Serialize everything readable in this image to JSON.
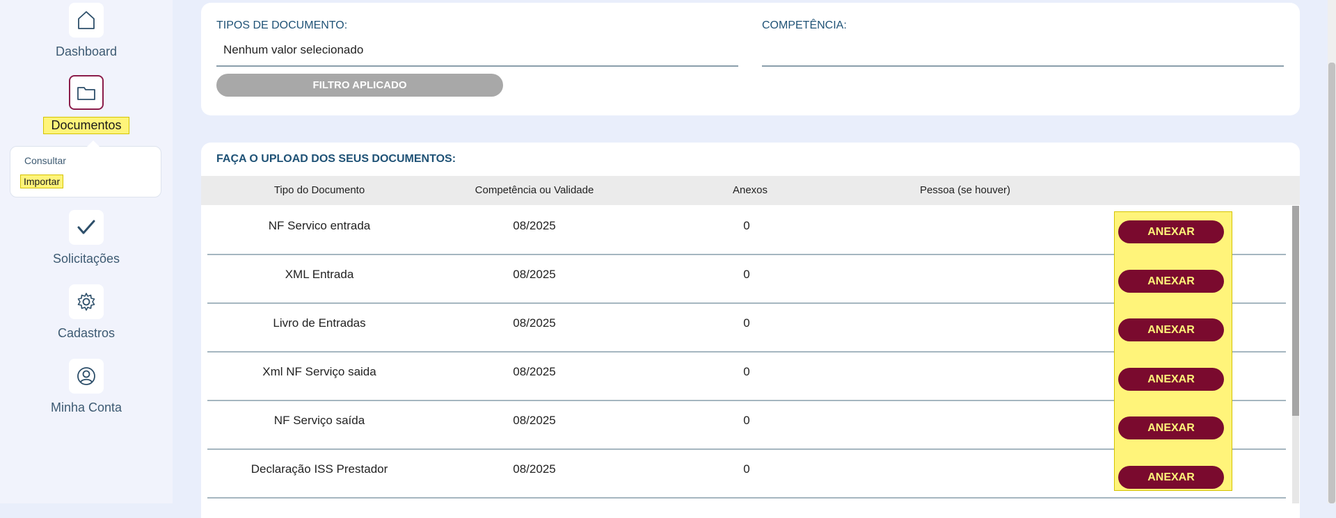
{
  "sidebar": {
    "items": [
      {
        "label": "Dashboard",
        "icon": "home-icon"
      },
      {
        "label": "Documentos",
        "icon": "folder-icon"
      },
      {
        "label": "Solicitações",
        "icon": "check-icon"
      },
      {
        "label": "Cadastros",
        "icon": "gear-icon"
      },
      {
        "label": "Minha Conta",
        "icon": "user-icon"
      }
    ],
    "submenu": {
      "consultar": "Consultar",
      "importar": "Importar"
    }
  },
  "filters": {
    "tipos_label": "TIPOS DE DOCUMENTO:",
    "tipos_value": "Nenhum valor selecionado",
    "competencia_label": "COMPETÊNCIA:",
    "competencia_value": "",
    "button_label": "FILTRO APLICADO"
  },
  "upload": {
    "title": "FAÇA O UPLOAD DOS SEUS DOCUMENTOS:",
    "columns": [
      "Tipo do Documento",
      "Competência ou Validade",
      "Anexos",
      "Pessoa (se houver)"
    ],
    "action_label": "ANEXAR",
    "rows": [
      {
        "tipo": "NF Servico entrada",
        "competencia": "08/2025",
        "anexos": "0",
        "pessoa": ""
      },
      {
        "tipo": "XML Entrada",
        "competencia": "08/2025",
        "anexos": "0",
        "pessoa": ""
      },
      {
        "tipo": "Livro de Entradas",
        "competencia": "08/2025",
        "anexos": "0",
        "pessoa": ""
      },
      {
        "tipo": "Xml NF Serviço saida",
        "competencia": "08/2025",
        "anexos": "0",
        "pessoa": ""
      },
      {
        "tipo": "NF Serviço saída",
        "competencia": "08/2025",
        "anexos": "0",
        "pessoa": ""
      },
      {
        "tipo": "Declaração ISS Prestador",
        "competencia": "08/2025",
        "anexos": "0",
        "pessoa": ""
      }
    ]
  },
  "colors": {
    "accent": "#7a0a2e",
    "highlight": "#fff47a",
    "heading": "#1f5276",
    "sidebar_bg": "#f1f3fc"
  }
}
